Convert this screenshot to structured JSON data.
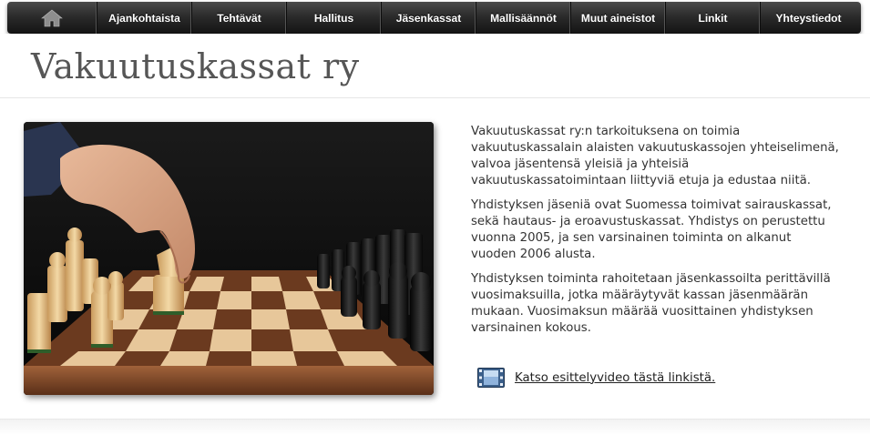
{
  "nav": {
    "home_icon": "home-icon",
    "items": [
      {
        "label": "Ajankohtaista"
      },
      {
        "label": "Tehtävät"
      },
      {
        "label": "Hallitus"
      },
      {
        "label": "Jäsenkassat"
      },
      {
        "label": "Mallisäännöt"
      },
      {
        "label": "Muut aineistot"
      },
      {
        "label": "Linkit"
      },
      {
        "label": "Yhteystiedot"
      }
    ]
  },
  "header": {
    "title": "Vakuutuskassat ry"
  },
  "main": {
    "image": "chess-hero-image",
    "paragraphs": [
      "Vakuutuskassat ry:n tarkoituksena on toimia vakuutuskassalain alaisten vakuutuskassojen yhteiselimenä, valvoa jäsentensä yleisiä ja yhteisiä vakuutuskassatoimintaan liittyviä etuja ja edustaa niitä.",
      "Yhdistyksen jäseniä ovat Suomessa toimivat sairauskassat, sekä hautaus- ja eroavustuskassat. Yhdistys on perustettu vuonna 2005, ja sen varsinainen toiminta on alkanut vuoden 2006 alusta.",
      "Yhdistyksen toiminta rahoitetaan jäsenkassoilta perittävillä vuosimaksuilla, jotka määräytyvät kassan jäsenmäärän mukaan. Vuosimaksun määrää vuosittainen yhdistyksen varsinainen kokous."
    ],
    "video_link": {
      "icon": "film-icon",
      "label": "Katso esittelyvideo tästä linkistä."
    }
  },
  "colors": {
    "nav_dark": "#141414",
    "nav_light": "#4a4a4a",
    "title_text": "#565656",
    "body_text": "#333333"
  }
}
